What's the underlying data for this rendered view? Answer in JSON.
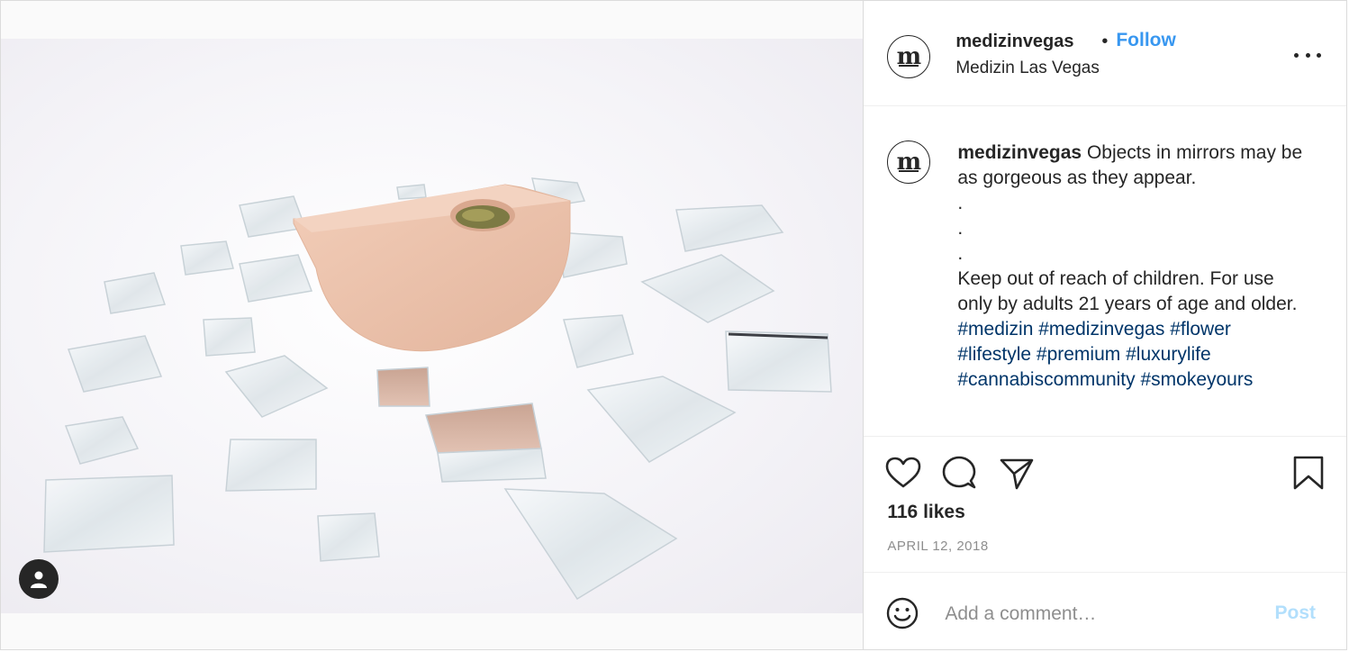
{
  "post": {
    "author": {
      "username": "medizinvegas",
      "avatar_letter": "m",
      "location": "Medizin Las Vegas"
    },
    "separator": "•",
    "follow_label": "Follow",
    "caption": {
      "author": "medizinvegas",
      "lines": [
        "Objects in mirrors may be as gorgeous as they appear.",
        ".",
        ".",
        ".",
        "Keep out of reach of children. For use only by adults 21 years of age and older."
      ],
      "hashtags": [
        "#medizin",
        "#medizinvegas",
        "#flower",
        "#lifestyle",
        "#premium",
        "#luxurylife",
        "#cannabiscommunity",
        "#smokeyours"
      ]
    },
    "likes": "116 likes",
    "date": "APRIL 12, 2018",
    "comment_placeholder": "Add a comment…",
    "post_label": "Post"
  },
  "icons": {
    "tag": "user-tag-icon",
    "more": "more-options-icon",
    "like": "heart-icon",
    "comment": "comment-icon",
    "share": "share-icon",
    "save": "bookmark-icon",
    "emoji": "emoji-icon"
  },
  "colors": {
    "follow": "#3897f0",
    "hashtag": "#003569",
    "post_disabled": "#b2dffc",
    "muted": "#8e8e8e"
  }
}
